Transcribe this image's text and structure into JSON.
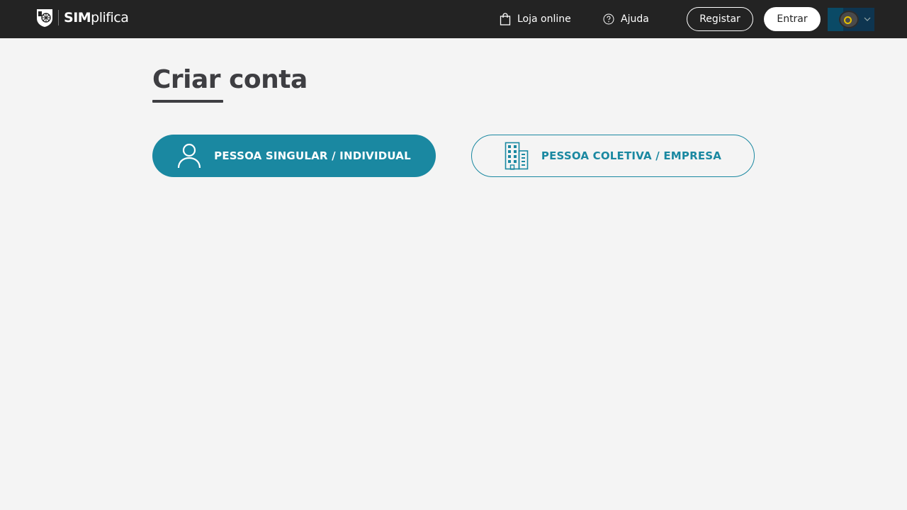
{
  "header": {
    "logo": {
      "brand_strong": "IM",
      "brand_light": "plifica",
      "brand_initial": "S"
    },
    "nav": {
      "shop_label": "Loja online",
      "help_label": "Ajuda"
    },
    "register_label": "Registar",
    "login_label": "Entrar",
    "language": {
      "icon": "language-flag-icon"
    }
  },
  "main": {
    "title": "Criar conta",
    "options": [
      {
        "label": "PESSOA SINGULAR / INDIVIDUAL",
        "icon": "user-icon",
        "state": "selected"
      },
      {
        "label": "PESSOA COLETIVA / EMPRESA",
        "icon": "building-icon",
        "state": "unselected"
      }
    ]
  },
  "colors": {
    "topbar": "#232323",
    "accent": "#1a88a1",
    "title": "#3e3e42",
    "background": "#f4f4f4"
  }
}
